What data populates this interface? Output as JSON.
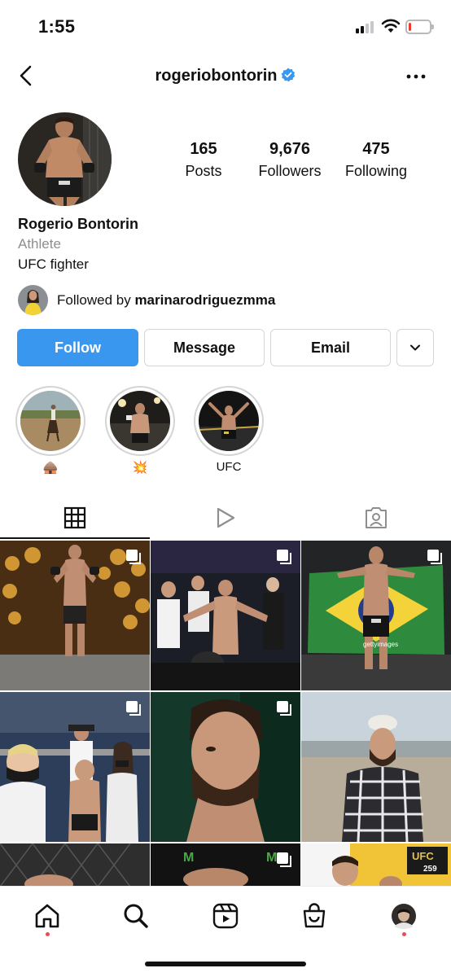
{
  "status_bar": {
    "time": "1:55",
    "battery_level": 0.12,
    "battery_color": "#ea3b2f"
  },
  "header": {
    "username": "rogeriobontorin",
    "verified_color": "#3897f0"
  },
  "profile": {
    "posts_count": "165",
    "posts_label": "Posts",
    "followers_count": "9,676",
    "followers_label": "Followers",
    "following_count": "475",
    "following_label": "Following",
    "name": "Rogerio Bontorin",
    "category": "Athlete",
    "bio": "UFC fighter",
    "followed_by_prefix": "Followed by ",
    "followed_by_user": "marinarodriguezmma"
  },
  "actions": {
    "follow": "Follow",
    "message": "Message",
    "email": "Email",
    "follow_color": "#3a97f0"
  },
  "highlights": [
    {
      "label": "🛖"
    },
    {
      "label": "💥"
    },
    {
      "label": "UFC"
    }
  ],
  "tabs": [
    {
      "name": "grid-icon",
      "active": true
    },
    {
      "name": "reels-icon",
      "active": false
    },
    {
      "name": "tagged-icon",
      "active": false
    }
  ],
  "grid_overlay_text": {
    "getty": "gettyimages",
    "ufc259_top": "UFC",
    "ufc259_bottom": "259"
  },
  "bottom_nav": [
    {
      "name": "home-icon",
      "dot": true
    },
    {
      "name": "search-icon",
      "dot": false
    },
    {
      "name": "reels-icon",
      "dot": false
    },
    {
      "name": "shop-icon",
      "dot": false
    },
    {
      "name": "profile-avatar-icon",
      "dot": true
    }
  ]
}
